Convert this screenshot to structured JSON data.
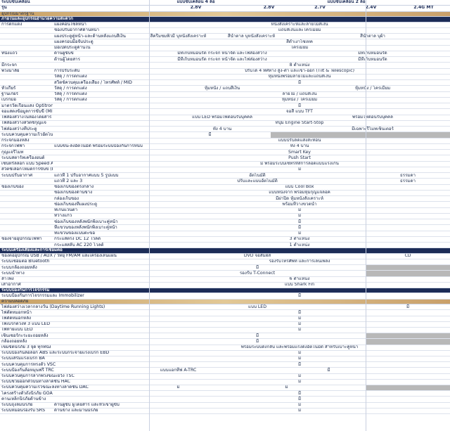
{
  "header": {
    "engine_label": "ระบบขับเคลื่อน",
    "model_label": "รุ่น",
    "drive_4wd": "แบบขับเคลื่อน 4 ล้อ",
    "drive_2wd": "แบบขับเคลื่อน 2 ล้อ",
    "models": [
      "2.8V",
      "2.8V",
      "2.7V",
      "2.4V",
      "2.4G MT"
    ]
  },
  "sections": {
    "std_equipment": "อุปกรณ์มาตรฐาน",
    "interior": "ภายในและอุปกรณ์อำนวยความสะดวก",
    "audio": "ระบบเครื่องเสียงและการเชื่อมต่อ",
    "security": "ระบบป้องกันการโจรกรรม",
    "safety": "ความปลอดภัย"
  },
  "rows": [
    {
      "a": "การตกแต่ง",
      "b": "แผงคอนโซลหน้า",
      "span": "หนังสังเคราะห์และลายไม้สีเงิน"
    },
    {
      "a": "",
      "b": "ช่องปรับอากาศด้านหน้า",
      "span": "แถบสีเงินและโครเมียม"
    },
    {
      "a": "",
      "b": "แผงประตูคู่หน้า-และด้านหลังแถบสีเงิน",
      "c1": "สีครีมชมพิ่วมี่ บุหนังสังเคราะห์",
      "c2": "สีน้ำตาล บุหนังสังเคราะห์",
      "c3": "สีน้ำตาล บุผ้า"
    },
    {
      "a": "",
      "b": "แผงครอบมือจับประตู",
      "span": "สีดำเงาโซเทค"
    },
    {
      "a": "",
      "b": "มือเปิดประตูด้านใน",
      "span": "โครเมียม"
    },
    {
      "a": "ที่นั่งแถว",
      "b": "ด้านผู้ขับขี่",
      "c1": "มีที่เก็บหมอนรัด กระจก หน้าจัด และไฟส่องสว่าง",
      "c3": "มีที่เก็บหมอนรัด"
    },
    {
      "a": "",
      "b": "ด้านผู้โดยสาร",
      "c1": "มีที่เก็บหมอนรัด กระจก หน้าจัด และไฟส่องสว่าง",
      "c3": "มีที่เก็บหมอนรัด"
    },
    {
      "a": "มีกระจก",
      "b": "",
      "span": "8 ตำแหน่ง"
    },
    {
      "a": "พวงมาลัย",
      "b": "การปรับระดับ",
      "span": "ปรับได้ 4 ทิศทาง สูง-ต่ำ และเข้า-ออก (Tilt & Telescopic)"
    },
    {
      "a": "",
      "b": "วัสดุ / การตกแต่ง",
      "span": "หุ้มหนังพร้อมลายไม้และแถบสีเงิน"
    },
    {
      "a": "",
      "b": "สวิตช์ควบคุมเครื่องเสียง / โทรศัพท์ / MID",
      "span": "มี"
    },
    {
      "a": "หัวเกียร์",
      "b": "วัสดุ / การตกแต่ง",
      "c1": "หุ้มหนัง / แถบสีเงิน",
      "c3": "หุ้มหนัง / โครเมียม"
    },
    {
      "a": "ฐานเกียร์",
      "b": "วัสดุ / การตกแต่ง",
      "span": "ลายไม้ / แถบสีเงิน"
    },
    {
      "a": "เบรกมือ",
      "b": "วัสดุ / การตกแต่ง",
      "span": "หุ้มหนัง / โครเมียม"
    },
    {
      "a": "มาตรวัดเรือนแสง Optitron",
      "b": "",
      "span": "มี"
    },
    {
      "a": "จอแสดงข้อมูลการขับขี่ (MID)",
      "b": "",
      "span": "จอสี แบบ TFT"
    },
    {
      "a": "ไฟส่องสว่างในห้องโดยสาร",
      "b": "",
      "c1": "แบบ LED พร้อมไฟต้อนรับบุคคล",
      "c3": "พร้อมไฟต้อนรับบุคคล"
    },
    {
      "a": "ไฟส่องสว่างสวิตช์กุญแจ",
      "b": "",
      "span": "ที่ปุ่ม Engine Start-Stop"
    },
    {
      "a": "ไฟส่องสว่างที่ประตู",
      "b": "",
      "c1": "ทั้ง 4 บาน",
      "c3": "มีเฉพาะรีโมทเซ็นเตอร์"
    },
    {
      "a": "ระบบควบคุมความเร็วอัตโนมัติ (Cruise Control)",
      "b": "",
      "c1": "มี",
      "greyRest": true
    },
    {
      "a": "กระจกมองหลัง",
      "b": "",
      "span": "แบบปรับลดแสงสะท้อน"
    },
    {
      "a": "กระจกไฟฟ้า",
      "b": "แบบขึ้น-ลงอัตโนมัติ พร้อมระบบป้องกันการหนีบ",
      "span": "ทั้ง 4 บาน"
    },
    {
      "a": "กุญแจรีโมท",
      "b": "",
      "span": "Smart Key"
    },
    {
      "a": "ระบบสตาร์ทเครื่องยนต์",
      "b": "",
      "span": "Push Start"
    },
    {
      "a": "เซ็นทรัลล็อก แบบ Speed Auto Lock",
      "b": "",
      "span": "มี พร้อมระบบเซ็ทรหัสการลอดแบบแรงเกิน"
    },
    {
      "a": "สวิตช์เลือกโหมดการขับขี่ (Eco / Power)",
      "b": "",
      "span": "มี"
    },
    {
      "a": "ระบบปรับอากาศ",
      "b": "แถวที่ 1 ปรับอากาศแบบ 5 รูปแบบ",
      "c1": "อัตโนมัติ",
      "c4": "ธรรมดา"
    },
    {
      "a": "",
      "b": "แถวที่ 2 และ 3",
      "span": "ปรับและแบบอัตโนมัติ",
      "c4": "ธรรมดา"
    },
    {
      "a": "ช่องเก็บของ",
      "b": "ช่องเก็บของตรงกลาง",
      "span": "แบบ Cool Box"
    },
    {
      "a": "",
      "b": "ช่องเก็บของด้านข้าง",
      "span": "แบบหนังจาก พร้อมหุ้มกุญแจล็อค"
    },
    {
      "a": "",
      "b": "กล่องเก็บของ",
      "span": "มีฝาปิด หุ้มหนังสังเคราะห์"
    },
    {
      "a": "",
      "b": "ช่องเก็บของที่แผงประตู",
      "span": "พร้อมที่วางขวดน้ำ"
    },
    {
      "a": "",
      "b": "ที่เก็บแว่นตา",
      "span": "มี"
    },
    {
      "a": "",
      "b": "ที่วางแก้ว",
      "span": "มี"
    },
    {
      "a": "",
      "b": "ช่องเก็บของหลังพนักพิงเบาะคู่หน้า",
      "span": "มี"
    },
    {
      "a": "",
      "b": "ที่แขวนของหลังพนักพิงเบาะคู่หน้า",
      "span": "มี"
    },
    {
      "a": "",
      "b": "ที่แขวนของแบบตะขอ",
      "span": "มี"
    },
    {
      "a": "ช่องจ่ายอุปกรณ์ไฟฟ้า",
      "b": "กระแสตรง DC 12 โวลต์",
      "span": "3 ตำแหน่ง"
    },
    {
      "a": "",
      "b": "กระแสสลับ AC 220 โวลต์",
      "span": "1 ตำแหน่ง"
    }
  ],
  "audio_rows": [
    {
      "a": "ช่องต่ออุปกรณ์ USB / AUX / วิทยุ FM/AM และเครื่องเล่นแผ่น",
      "c1": "DVD จอสัมผัส",
      "c4": "CD"
    },
    {
      "a": "ระบบเชื่อมต่อ Bluetooth",
      "span": "รองรับโทรศัพท์ และการเล่นเพลง"
    },
    {
      "a": "ระบบกล้องถอยหลัง",
      "span": "มี",
      "grey4": true
    },
    {
      "a": "ระบบนำทาง",
      "span": "รองรับ T-Connect",
      "grey4": true
    },
    {
      "a": "ลำโพง",
      "span": "6 ตำแหน่ง"
    },
    {
      "a": "เสาอากาศ",
      "span": "แบบ Shark Fin"
    }
  ],
  "security_rows": [
    {
      "a": "ระบบป้องกันการโจรกรรมและ Immobilizer",
      "span": "มี"
    }
  ],
  "safety_rows": [
    {
      "a": "ไฟส่องสว่างเวลากลางวัน (Daytime Running Lights)",
      "c1": "แบบ LED",
      "c4": "มี"
    },
    {
      "a": "ไฟตัดหมอกหน้า",
      "span": "มี"
    },
    {
      "a": "ไฟตัดหมอกหลัง",
      "span": "มี"
    },
    {
      "a": "ไฟเบรกดวงที่ 3 แบบ LED",
      "span": "มี"
    },
    {
      "a": "ไฟท้ายแบบ LED",
      "span": "มี"
    },
    {
      "a": "เซ็นเซอร์กะระยะถอยหลัง",
      "span": "มี",
      "grey4": true
    },
    {
      "a": "กล้องถอยหลัง",
      "span": "มี",
      "grey4": true
    },
    {
      "a": "เข็มขัดนิรภัย 3 จุด ทุกที่นั่ง",
      "span": "พร้อมระบบดึงกลับ และพร้อมแรงดึงอัตโนมัติ สำหรับเบาะคู่หน้า"
    },
    {
      "a": "ระบบป้องกันล้อล็อก ABS และระบบกระจายแรงเบรก EBD",
      "span": "มี"
    },
    {
      "a": "ระบบเสริมแรงเบรก BA",
      "span": "มี"
    },
    {
      "a": "ระบบควบคุมการทรงตัว VSC",
      "span": "มี"
    },
    {
      "a": "ระบบป้องกันล้อหมุนฟรี TRC",
      "c1": "แบบแอกทีฟ A-TRC",
      "c2": "มี"
    },
    {
      "a": "ระบบควบคุมการลากพ่วงขณะยวัง TSC",
      "span": "มี"
    },
    {
      "a": "ระบบช่วยออกตัวบนทางลาดชัน HAC",
      "span": "มี"
    },
    {
      "a": "ระบบควบคุมความเร็วขณะลงทางลาดชัน DAC",
      "c1": "มี",
      "c2": "มี",
      "grey4": true
    },
    {
      "a": "โครงสร้างตัวถังนิรภัย GOA",
      "span": "มี"
    },
    {
      "a": "คานเหล็กนิรภัยด้านข้าง",
      "span": "มี"
    },
    {
      "a": "ระบบถุงลมนิรภัย",
      "b": "ด้านผู้ขับ ผู้โดยสาร และหัวเข่าผู้ขับ",
      "span": "มี"
    },
    {
      "a": "ระบบหมอนรองรับ SRS",
      "b": "ด้านข้าง และม่านนิรภัย",
      "span": "มี"
    }
  ]
}
